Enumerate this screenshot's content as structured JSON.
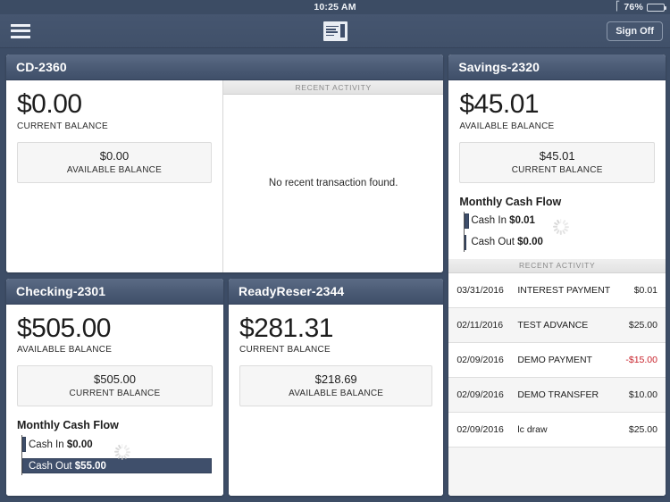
{
  "status_bar": {
    "time": "10:25 AM",
    "bluetooth_icon": "bluetooth-icon",
    "battery_percent": "76%",
    "battery_level": 76
  },
  "navbar": {
    "menu_icon": "hamburger-menu-icon",
    "logo_icon": "check-document-logo-icon",
    "sign_off_label": "Sign Off"
  },
  "labels": {
    "recent_activity": "RECENT ACTIVITY",
    "no_transactions": "No recent transaction found.",
    "monthly_cash_flow": "Monthly Cash Flow",
    "cash_in": "Cash In",
    "cash_out": "Cash Out"
  },
  "colors": {
    "app_background": "#3d4d66",
    "card_header_top": "#5b6b85",
    "card_header_bottom": "#3f4f69",
    "bar_fill": "#3f4f6b",
    "negative_amount": "#c8232c"
  },
  "accounts": {
    "cd": {
      "title": "CD-2360",
      "primary_amount": "$0.00",
      "primary_label": "CURRENT BALANCE",
      "secondary_amount": "$0.00",
      "secondary_label": "AVAILABLE BALANCE"
    },
    "checking": {
      "title": "Checking-2301",
      "primary_amount": "$505.00",
      "primary_label": "AVAILABLE BALANCE",
      "secondary_amount": "$505.00",
      "secondary_label": "CURRENT BALANCE",
      "cash_in": "$0.00",
      "cash_out": "$55.00"
    },
    "ready_reserve": {
      "title": "ReadyReser-2344",
      "primary_amount": "$281.31",
      "primary_label": "CURRENT BALANCE",
      "secondary_amount": "$218.69",
      "secondary_label": "AVAILABLE BALANCE"
    },
    "savings": {
      "title": "Savings-2320",
      "primary_amount": "$45.01",
      "primary_label": "AVAILABLE BALANCE",
      "secondary_amount": "$45.01",
      "secondary_label": "CURRENT BALANCE",
      "cash_in": "$0.01",
      "cash_out": "$0.00"
    }
  },
  "savings_transactions": [
    {
      "date": "03/31/2016",
      "description": "INTEREST PAYMENT",
      "amount": "$0.01",
      "negative": false
    },
    {
      "date": "02/11/2016",
      "description": "TEST ADVANCE",
      "amount": "$25.00",
      "negative": false
    },
    {
      "date": "02/09/2016",
      "description": "DEMO PAYMENT",
      "amount": "-$15.00",
      "negative": true
    },
    {
      "date": "02/09/2016",
      "description": "DEMO TRANSFER",
      "amount": "$10.00",
      "negative": false
    },
    {
      "date": "02/09/2016",
      "description": "lc draw",
      "amount": "$25.00",
      "negative": false
    }
  ]
}
